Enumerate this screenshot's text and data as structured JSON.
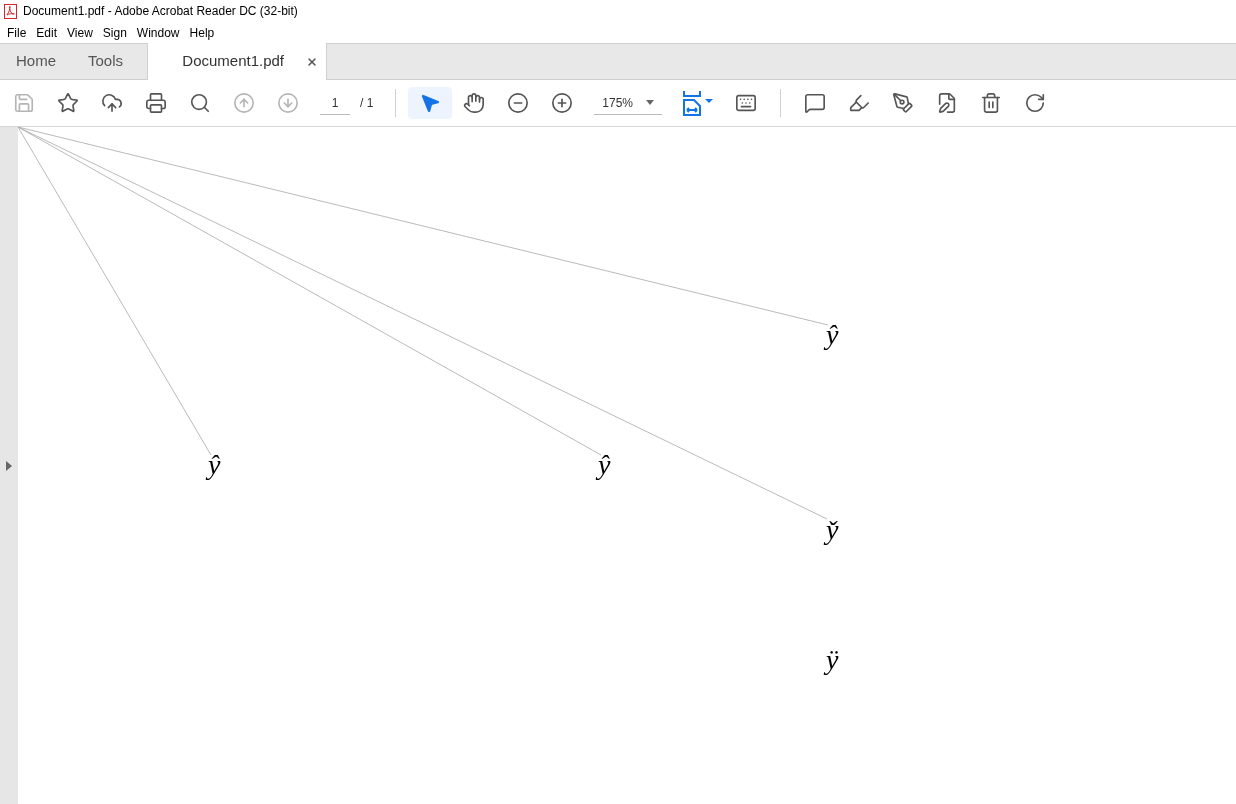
{
  "window": {
    "title": "Document1.pdf - Adobe Acrobat Reader DC (32-bit)"
  },
  "menu": [
    "File",
    "Edit",
    "View",
    "Sign",
    "Window",
    "Help"
  ],
  "tabs": [
    {
      "label": "Home",
      "selected": false,
      "closable": false
    },
    {
      "label": "Tools",
      "selected": false,
      "closable": false
    },
    {
      "label": "Document1.pdf",
      "selected": true,
      "closable": true
    }
  ],
  "toolbar": [
    {
      "kind": "save",
      "disabled": true,
      "selected": false
    },
    {
      "kind": "bookmark",
      "disabled": false,
      "selected": false
    },
    {
      "kind": "upload",
      "disabled": false,
      "selected": false
    },
    {
      "kind": "print",
      "disabled": false,
      "selected": false
    },
    {
      "kind": "find",
      "disabled": false,
      "selected": false
    },
    {
      "kind": "prev",
      "disabled": true,
      "selected": false
    },
    {
      "kind": "next",
      "disabled": true,
      "selected": false
    },
    {
      "kind": "page",
      "value": "1",
      "total": "/ 1"
    },
    {
      "kind": "separator"
    },
    {
      "kind": "select",
      "disabled": false,
      "selected": true
    },
    {
      "kind": "hand",
      "disabled": false,
      "selected": false
    },
    {
      "kind": "zoomout",
      "disabled": false,
      "selected": false
    },
    {
      "kind": "zoomin",
      "disabled": false,
      "selected": false
    },
    {
      "kind": "zoom",
      "value": "175%"
    },
    {
      "kind": "fit",
      "disabled": false,
      "selected": false
    },
    {
      "kind": "scroll",
      "disabled": false,
      "selected": false
    },
    {
      "kind": "separator"
    },
    {
      "kind": "comment",
      "disabled": false,
      "selected": false
    },
    {
      "kind": "highlight",
      "disabled": false,
      "selected": false
    },
    {
      "kind": "sign",
      "disabled": false,
      "selected": false
    },
    {
      "kind": "edit",
      "disabled": false,
      "selected": false
    },
    {
      "kind": "delete",
      "disabled": false,
      "selected": false
    },
    {
      "kind": "rotate",
      "disabled": false,
      "selected": false
    }
  ],
  "document": {
    "glyphs": [
      {
        "text": "ŷ",
        "connected": true
      },
      {
        "text": "ŷ",
        "connected": true
      },
      {
        "text": "ŷ",
        "connected": true
      },
      {
        "text": "y̌",
        "connected": true
      },
      {
        "text": "ÿ",
        "connected": false
      }
    ]
  }
}
